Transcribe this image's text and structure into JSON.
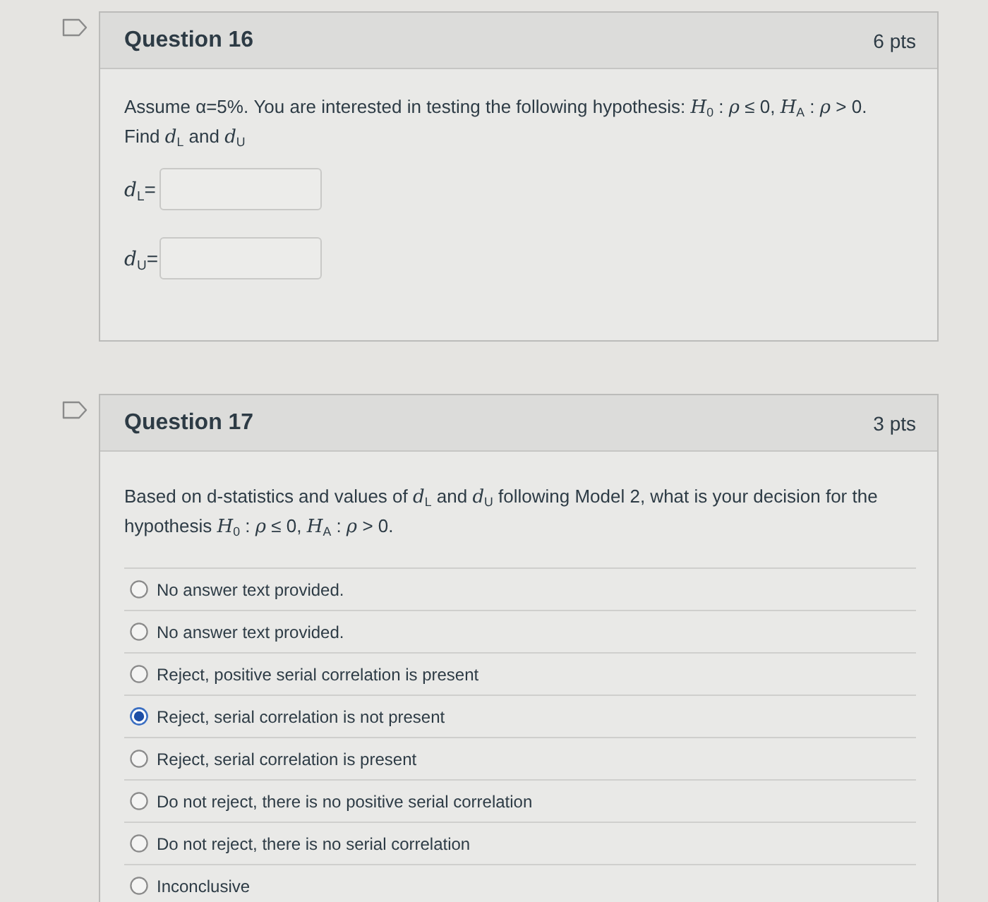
{
  "questions": [
    {
      "kind": "fill_in",
      "title": "Question 16",
      "points": "6 pts",
      "flagged": false,
      "prompt": [
        "Assume α=5%. You are interested in testing the following hypothesis: *H*$_{0}$ : *ρ* ≤ 0, *H*$_{A}$ : *ρ* > 0.",
        "Find *d*$_{L}$ and *d*$_{U}$"
      ],
      "blanks": [
        {
          "label": "*d*$_{L}$="
        },
        {
          "label": "*d*$_{U}$="
        }
      ]
    },
    {
      "kind": "multiple_choice",
      "title": "Question 17",
      "points": "3 pts",
      "flagged": false,
      "prompt": [
        "Based on d-statistics and values of *d*$_{L}$ and *d*$_{U}$ following Model 2, what is your decision for the hypothesis *H*$_{0}$ : *ρ* ≤ 0, *H*$_{A}$ : *ρ* > 0."
      ],
      "options": [
        {
          "label": "No answer text provided.",
          "selected": false
        },
        {
          "label": "No answer text provided.",
          "selected": false
        },
        {
          "label": "Reject, positive serial correlation is present",
          "selected": false
        },
        {
          "label": "Reject, serial correlation is not present",
          "selected": true
        },
        {
          "label": "Reject, serial correlation is present",
          "selected": false
        },
        {
          "label": "Do not reject, there is no positive serial correlation",
          "selected": false
        },
        {
          "label": "Do not reject, there is no serial correlation",
          "selected": false
        },
        {
          "label": "Inconclusive",
          "selected": false
        }
      ]
    }
  ]
}
